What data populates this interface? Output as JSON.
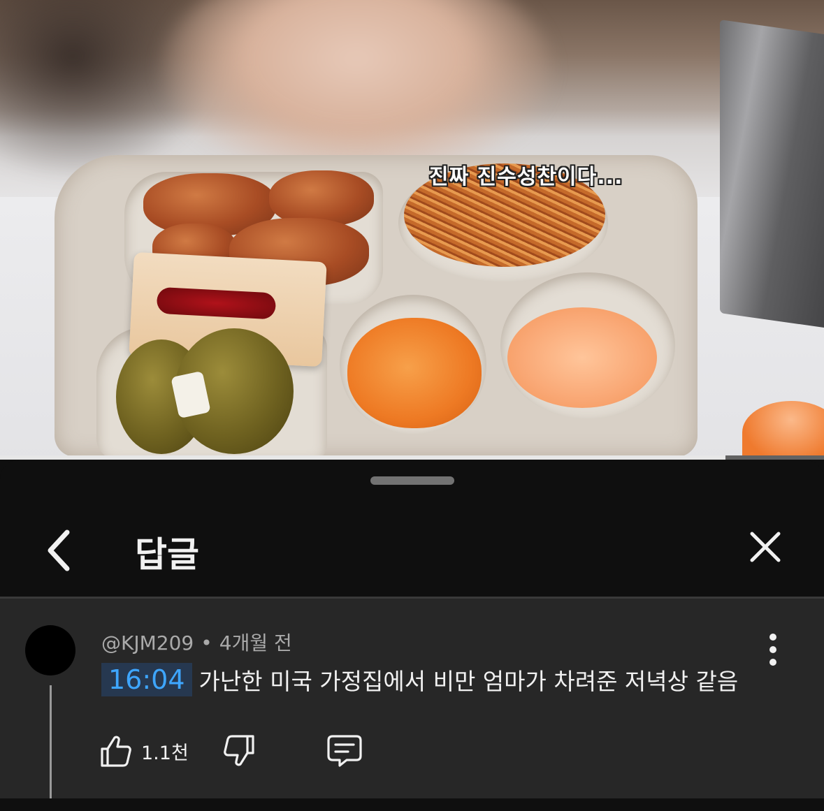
{
  "video": {
    "caption": "진짜 진수성찬이다...",
    "progress": 0.88
  },
  "header": {
    "title": "답글",
    "back_icon": "chevron-left-icon",
    "close_icon": "close-icon"
  },
  "comment": {
    "author": "@KJM209",
    "separator": "•",
    "time_ago": "4개월 전",
    "timestamp": "16:04",
    "text": "가난한 미국 가정집에서 비만 엄마가 차려준 저녁상 같음",
    "like_count": "1.1천",
    "icons": [
      "thumbs-up-icon",
      "thumbs-down-icon",
      "reply-icon",
      "more-vertical-icon"
    ]
  },
  "colors": {
    "sheet_bg": "#0f0f0f",
    "comment_bg": "#272727",
    "timestamp_link": "#3ea6ff",
    "timestamp_bg": "#263850"
  }
}
